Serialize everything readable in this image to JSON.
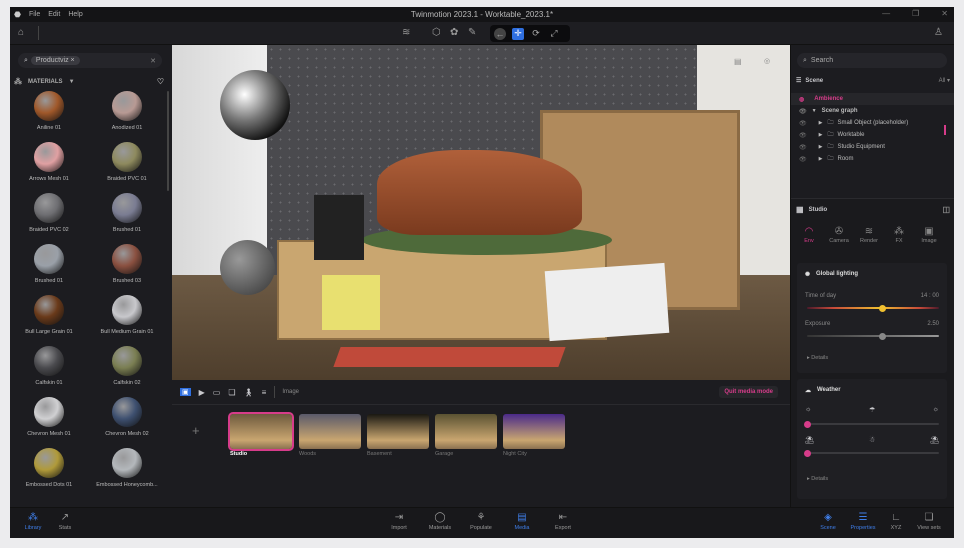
{
  "titlebar": {
    "menu": [
      "File",
      "Edit",
      "Help"
    ],
    "title": "Twinmotion 2023.1 - Worktable_2023.1*"
  },
  "library": {
    "search_chip": "Productviz",
    "section": "MATERIALS",
    "materials": [
      {
        "name": "Aniline 01",
        "color": "#a0582a"
      },
      {
        "name": "Anodized 01",
        "color": "#b89a94"
      },
      {
        "name": "Arrows Mesh 01",
        "color": "#e0a0a2"
      },
      {
        "name": "Braided PVC 01",
        "color": "#8e8a5e"
      },
      {
        "name": "Braided PVC 02",
        "color": "#6e6e72"
      },
      {
        "name": "Brushed 01",
        "color": "#7a7c92"
      },
      {
        "name": "Brushed 01",
        "color": "#9aa0a8"
      },
      {
        "name": "Brushed 03",
        "color": "#8a5040"
      },
      {
        "name": "Bull Large Grain 01",
        "color": "#6a3a1a"
      },
      {
        "name": "Bull Medium Grain 01",
        "color": "#c8c8cc"
      },
      {
        "name": "Calfskin 01",
        "color": "#4a4a4e"
      },
      {
        "name": "Calfskin 02",
        "color": "#7a7e52"
      },
      {
        "name": "Chevron Mesh 01",
        "color": "#d0d0d2"
      },
      {
        "name": "Chevron Mesh 02",
        "color": "#3e5070"
      },
      {
        "name": "Embossed Dots 01",
        "color": "#b09a3a"
      },
      {
        "name": "Embossed Honeycomb...",
        "color": "#b4b8bc"
      }
    ]
  },
  "media": {
    "mode_label": "Image",
    "quit_label": "Quit media mode",
    "thumbnails": [
      {
        "label": "Studio",
        "selected": true,
        "color": "#6e5a3e"
      },
      {
        "label": "Woods",
        "selected": false,
        "color": "#5a5a6a"
      },
      {
        "label": "Basement",
        "selected": false,
        "color": "#1a1812"
      },
      {
        "label": "Garage",
        "selected": false,
        "color": "#5a5232"
      },
      {
        "label": "Night City",
        "selected": false,
        "color": "#4a2a8a"
      }
    ]
  },
  "scene": {
    "search_placeholder": "Search",
    "title": "Scene",
    "filter": "All",
    "ambience": "Ambience",
    "graph": "Scene graph",
    "items": [
      "Small Object (placeholder)",
      "Worktable",
      "Studio Equipment",
      "Room"
    ]
  },
  "properties": {
    "title": "Studio",
    "tabs": [
      "Env",
      "Camera",
      "Render",
      "FX",
      "Image"
    ],
    "global_lighting": "Global lighting",
    "time_label": "Time of day",
    "time_value": "14 : 00",
    "time_fraction": 0.57,
    "exposure_label": "Exposure",
    "exposure_value": "2.50",
    "exposure_fraction": 0.57,
    "details": "Details",
    "weather": "Weather",
    "weather_fraction": 0,
    "season_fraction": 0
  },
  "bottom": {
    "left": [
      "Library",
      "Stats"
    ],
    "center": [
      "Import",
      "Materials",
      "Populate",
      "Media",
      "Export"
    ],
    "right": [
      "Scene",
      "Properties",
      "XYZ",
      "View sets"
    ]
  },
  "colors": {
    "accent": "#3f7ee8",
    "highlight": "#d63c8a"
  }
}
